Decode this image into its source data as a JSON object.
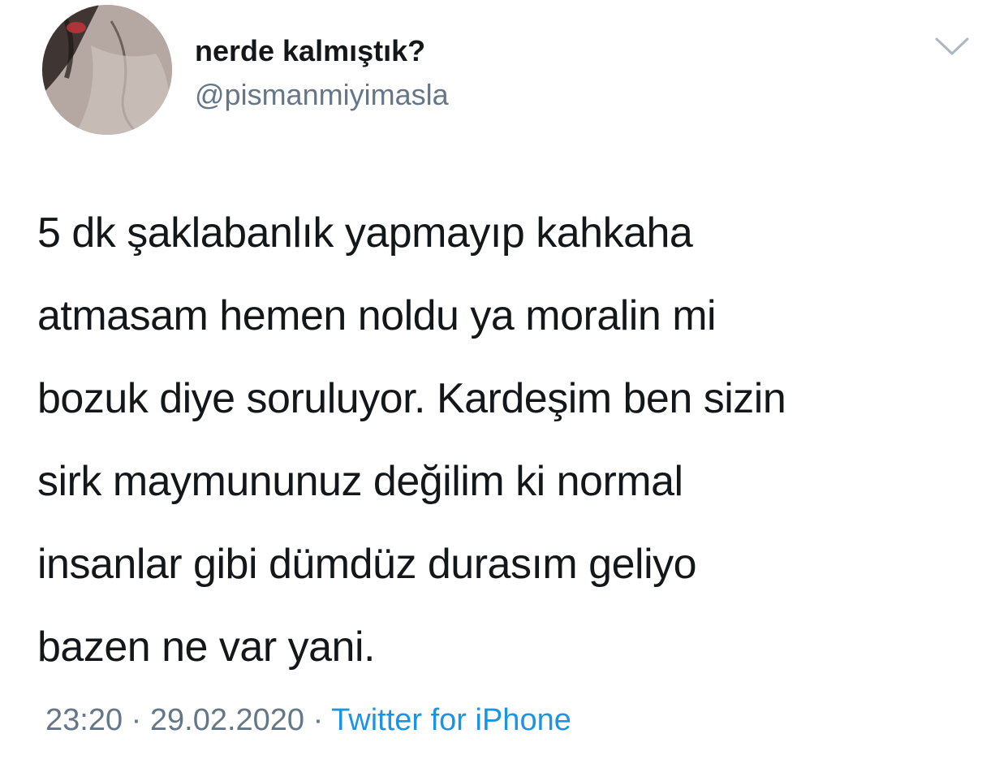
{
  "user": {
    "display_name": "nerde kalmıştık?",
    "handle": "@pismanmiyimasla"
  },
  "tweet": {
    "lines": [
      "5 dk şaklabanlık yapmayıp kahkaha",
      "atmasam hemen noldu ya moralin mi",
      "bozuk diye soruluyor. Kardeşim ben sizin",
      "sirk maymununuz değilim ki normal",
      "insanlar gibi dümdüz durasım geliyo",
      "bazen ne var yani."
    ],
    "time": "23:20",
    "date": "29.02.2020",
    "separator": "·",
    "source": "Twitter for iPhone"
  },
  "icons": {
    "avatar": "profile-photo",
    "menu": "chevron-down-icon"
  },
  "colors": {
    "text_primary": "#14171a",
    "text_secondary": "#657786",
    "link": "#1b95e0"
  }
}
